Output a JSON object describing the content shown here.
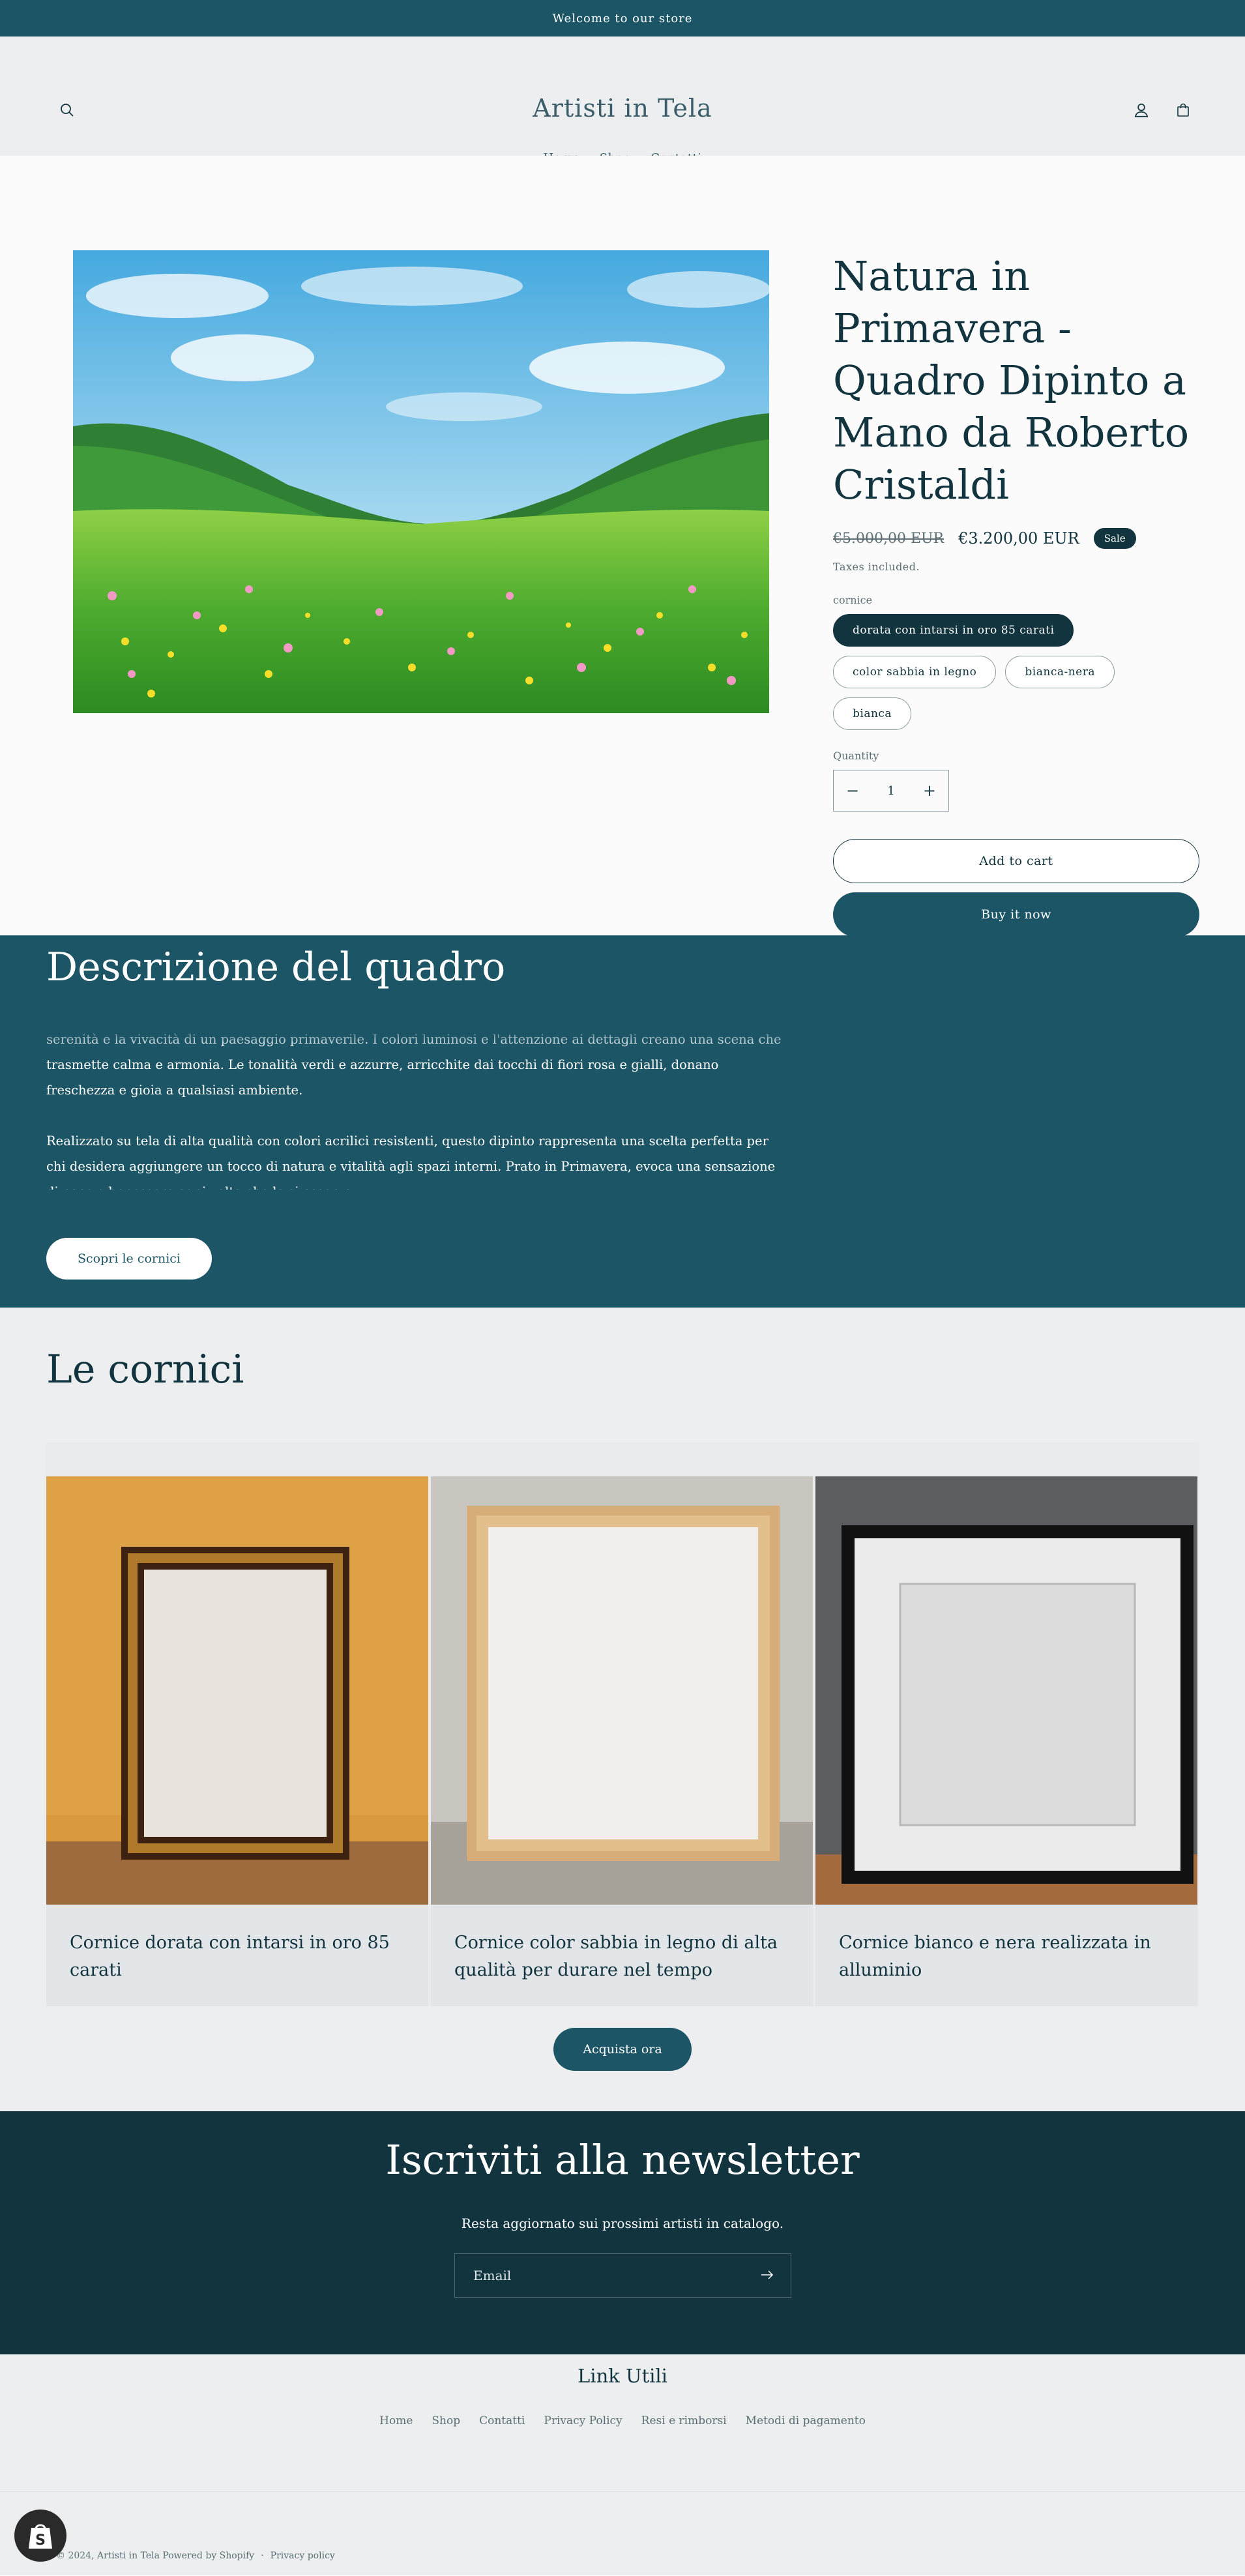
{
  "announcement": "Welcome to our store",
  "header": {
    "logo": "Artisti in Tela",
    "nav": [
      "Home",
      "Shop",
      "Contatti"
    ]
  },
  "product": {
    "title": "Natura in Primavera - Quadro Dipinto a Mano da Roberto Cristaldi",
    "price_old": "€5.000,00 EUR",
    "price_new": "€3.200,00 EUR",
    "sale_badge": "Sale",
    "taxes": "Taxes included.",
    "option_label": "cornice",
    "options": [
      "dorata con intarsi in oro 85 carati",
      "color sabbia in legno",
      "bianca-nera",
      "bianca"
    ],
    "selected_option": "dorata con intarsi in oro 85 carati",
    "quantity_label": "Quantity",
    "quantity": "1",
    "minus": "−",
    "plus": "+",
    "add_to_cart": "Add to cart",
    "buy_now": "Buy it now"
  },
  "description": {
    "title": "Descrizione del quadro",
    "paragraph1": "serenità e la vivacità di un paesaggio primaverile. I colori luminosi e l'attenzione ai dettagli creano una scena che trasmette calma e armonia. Le tonalità verdi e azzurre, arricchite dai tocchi di fiori rosa e gialli, donano freschezza e gioia a qualsiasi ambiente.",
    "paragraph2": "Realizzato su tela di alta qualità con colori acrilici resistenti, questo dipinto rappresenta una scelta perfetta per chi desidera aggiungere un tocco di natura e vitalità agli spazi interni. Prato in Primavera, evoca una sensazione di pace e benessere ogni volta che lo si osserva.",
    "cta": "Scopri le cornici"
  },
  "frames": {
    "title": "Le cornici",
    "cards": [
      {
        "caption": "Cornice dorata con intarsi in oro 85 carati"
      },
      {
        "caption": "Cornice color sabbia in legno di alta qualità per durare nel tempo"
      },
      {
        "caption": "Cornice bianco e nera realizzata in alluminio"
      }
    ],
    "cta": "Acquista ora"
  },
  "newsletter": {
    "title": "Iscriviti alla newsletter",
    "subtitle": "Resta aggiornato sui prossimi artisti in catalogo.",
    "placeholder": "Email"
  },
  "footer": {
    "title": "Link Utili",
    "links": [
      "Home",
      "Shop",
      "Contatti",
      "Privacy Policy",
      "Resi e rimborsi",
      "Metodi di pagamento"
    ],
    "copyright": "© 2024, Artisti in Tela Powered by Shopify",
    "separator": "·",
    "privacy": "Privacy policy"
  },
  "colors": {
    "primary": "#1b5566",
    "dark": "#12343f",
    "background_light": "#eceeef"
  }
}
